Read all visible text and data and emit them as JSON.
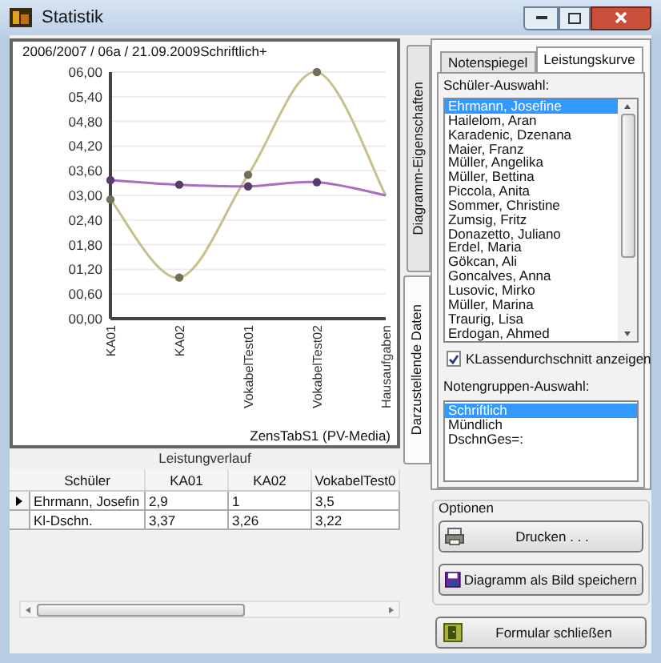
{
  "window": {
    "title": "Statistik"
  },
  "chart_panel": {
    "header": "2006/2007 / 06a / 21.09.2009Schriftlich+",
    "footer": "ZensTabS1 (PV-Media)",
    "chart_data": {
      "type": "line",
      "categories": [
        "KA01",
        "KA02",
        "VokabelTest01",
        "VokabelTest02",
        "Hausaufgaben"
      ],
      "grid": true,
      "series": [
        {
          "color": "#c8c08c",
          "marker": "circle",
          "values": [
            2.9,
            1,
            3.5,
            6,
            3.0
          ]
        },
        {
          "color": "#a86cc0",
          "marker": "circle",
          "values": [
            3.37,
            3.26,
            3.22,
            3.32,
            3.0
          ]
        }
      ],
      "ylim": [
        0,
        6
      ],
      "yticks": [
        {
          "value": 0,
          "label": "00,00"
        },
        {
          "value": 0.6,
          "label": "00,60"
        },
        {
          "value": 1.2,
          "label": "01,20"
        },
        {
          "value": 1.8,
          "label": "01,80"
        },
        {
          "value": 2.4,
          "label": "02,40"
        },
        {
          "value": 3,
          "label": "03,00"
        },
        {
          "value": 3.6,
          "label": "03,60"
        },
        {
          "value": 4.2,
          "label": "04,20"
        },
        {
          "value": 4.8,
          "label": "04,80"
        },
        {
          "value": 5.4,
          "label": "05,40"
        },
        {
          "value": 6,
          "label": "06,00"
        }
      ]
    }
  },
  "grid": {
    "title": "Leistungverlauf",
    "columns": [
      "Schüler",
      "KA01",
      "KA02",
      "VokabelTest0"
    ],
    "rows": [
      {
        "selected": true,
        "cells": [
          "Ehrmann, Josefin",
          "2,9",
          "1",
          "3,5"
        ]
      },
      {
        "selected": false,
        "cells": [
          "Kl-Dschn.",
          "3,37",
          "3,26",
          "3,22"
        ]
      }
    ]
  },
  "side_tabs": [
    {
      "label": "Diagramm-Eigenschaften",
      "selected": false
    },
    {
      "label": "Darzustellende Daten",
      "selected": true
    }
  ],
  "tabs": [
    {
      "label": "Notenspiegel",
      "selected": false
    },
    {
      "label": "Leistungskurve",
      "selected": true
    }
  ],
  "student_list": {
    "label": "Schüler-Auswahl:",
    "items": [
      {
        "label": "Ehrmann, Josefine",
        "selected": true
      },
      {
        "label": "Hailelom, Aran",
        "selected": false
      },
      {
        "label": "Karadenic, Dzenana",
        "selected": false
      },
      {
        "label": "Maier, Franz",
        "selected": false
      },
      {
        "label": "Müller, Angelika",
        "selected": false
      },
      {
        "label": "Müller, Bettina",
        "selected": false
      },
      {
        "label": "Piccola, Anita",
        "selected": false
      },
      {
        "label": "Sommer, Christine",
        "selected": false
      },
      {
        "label": "Zumsig, Fritz",
        "selected": false
      },
      {
        "label": "Donazetto, Juliano",
        "selected": false
      },
      {
        "label": "Erdel, Maria",
        "selected": false
      },
      {
        "label": "Gökcan, Ali",
        "selected": false
      },
      {
        "label": "Goncalves, Anna",
        "selected": false
      },
      {
        "label": "Lusovic, Mirko",
        "selected": false
      },
      {
        "label": "Müller, Marina",
        "selected": false
      },
      {
        "label": "Traurig, Lisa",
        "selected": false
      },
      {
        "label": "Erdogan, Ahmed",
        "selected": false
      }
    ]
  },
  "class_average": {
    "label": "KLassendurchschnitt anzeigen",
    "checked": true
  },
  "group_list": {
    "label": "Notengruppen-Auswahl:",
    "items": [
      {
        "label": "Schriftlich",
        "selected": true
      },
      {
        "label": "Mündlich",
        "selected": false
      },
      {
        "label": "DschnGes=:",
        "selected": false
      }
    ]
  },
  "options": {
    "title": "Optionen",
    "buttons": [
      {
        "label": "Drucken . . .",
        "kind": "print"
      },
      {
        "label": "Diagramm als Bild speichern",
        "kind": "save"
      }
    ]
  },
  "close_button": {
    "label": "Formular schließen",
    "kind": "exit"
  }
}
